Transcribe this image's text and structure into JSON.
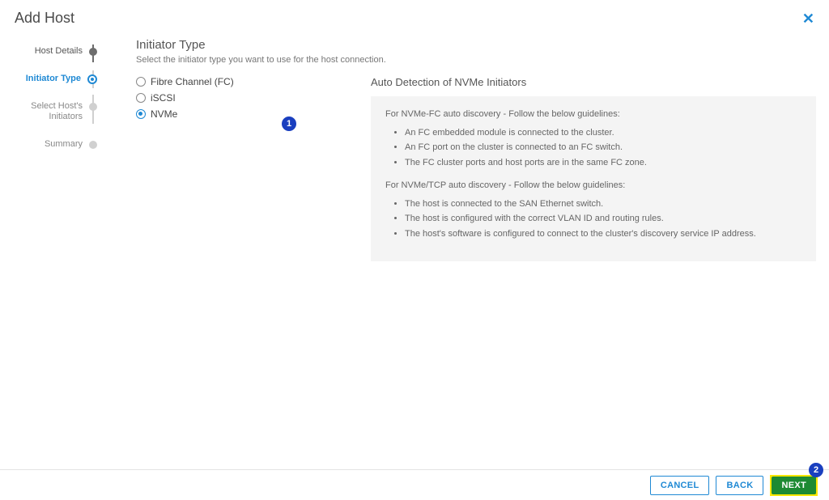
{
  "header": {
    "title": "Add Host"
  },
  "stepper": {
    "items": [
      {
        "label": "Host Details",
        "state": "done"
      },
      {
        "label": "Initiator Type",
        "state": "active"
      },
      {
        "label": "Select Host's Initiators",
        "state": "pending"
      },
      {
        "label": "Summary",
        "state": "pending"
      }
    ]
  },
  "main": {
    "title": "Initiator Type",
    "subtitle": "Select the initiator type you want to use for the host connection.",
    "options": [
      {
        "label": "Fibre Channel (FC)",
        "selected": false
      },
      {
        "label": "iSCSI",
        "selected": false
      },
      {
        "label": "NVMe",
        "selected": true
      }
    ],
    "panel": {
      "title": "Auto Detection of NVMe Initiators",
      "fc_intro": "For NVMe-FC auto discovery - Follow the below guidelines:",
      "fc_items": [
        "An FC embedded module is connected to the cluster.",
        "An FC port on the cluster is connected to an FC switch.",
        "The FC cluster ports and host ports are in the same FC zone."
      ],
      "tcp_intro": "For NVMe/TCP auto discovery - Follow the below guidelines:",
      "tcp_items": [
        "The host is connected to the SAN Ethernet switch.",
        "The host is configured with the correct VLAN ID and routing rules.",
        "The host's software is configured to connect to the cluster's discovery service IP address."
      ]
    }
  },
  "callouts": {
    "one": "1",
    "two": "2"
  },
  "footer": {
    "cancel": "CANCEL",
    "back": "BACK",
    "next": "NEXT"
  }
}
